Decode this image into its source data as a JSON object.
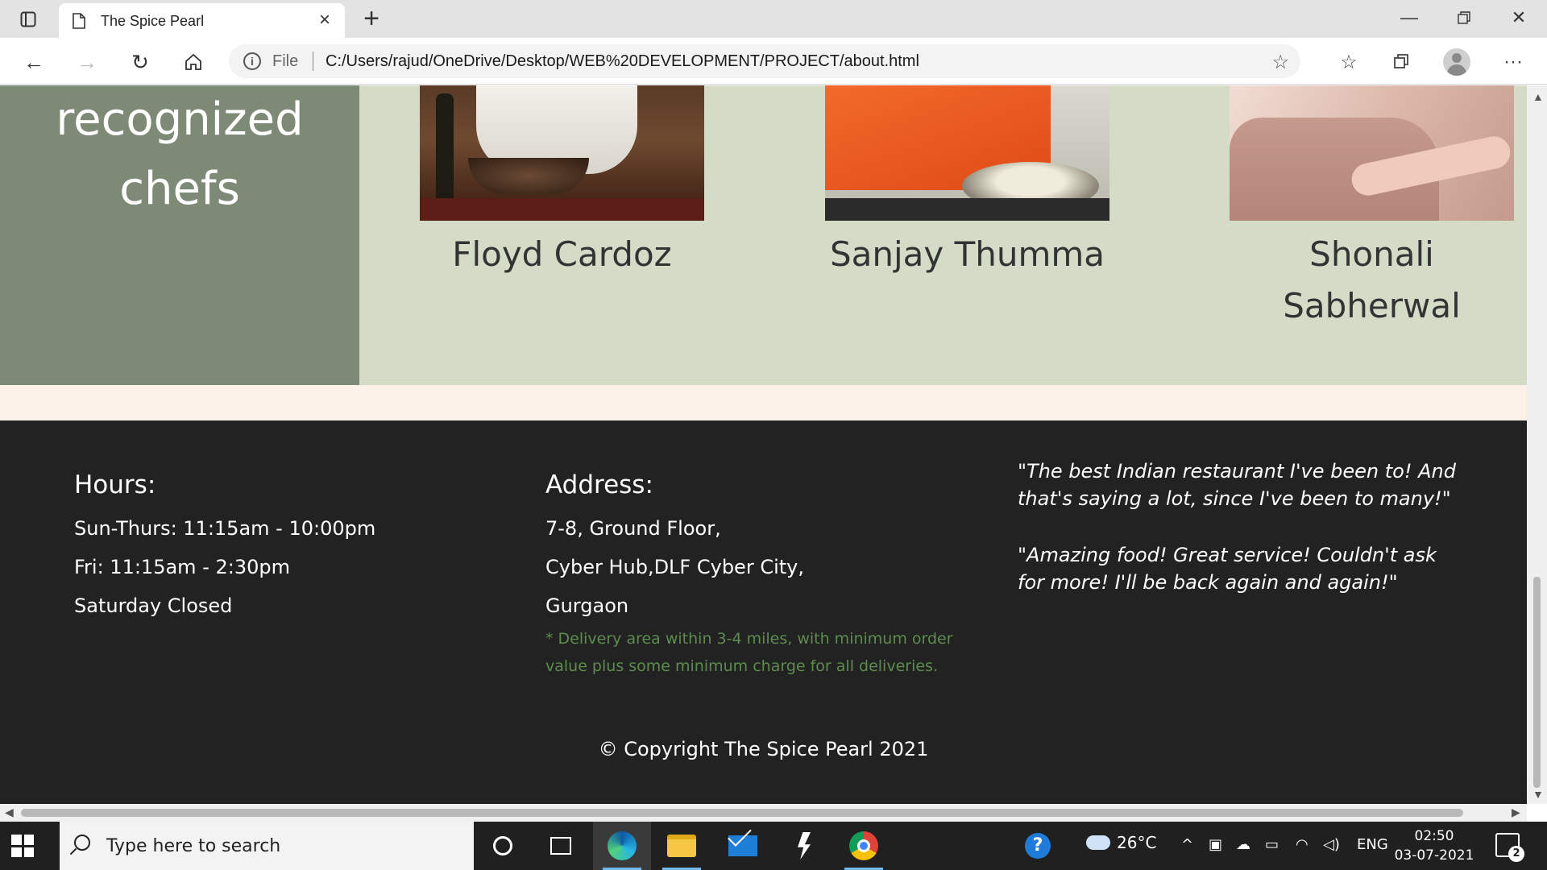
{
  "browser": {
    "tab_title": "The Spice Pearl",
    "new_tab_symbol": "+",
    "address": {
      "scheme_label": "File",
      "url": "C:/Users/rajud/OneDrive/Desktop/WEB%20DEVELOPMENT/PROJECT/about.html"
    },
    "icons": [
      "tab-actions-icon",
      "page-icon",
      "close-icon",
      "minimize-icon",
      "restore-icon",
      "window-close-icon",
      "back-icon",
      "forward-icon",
      "refresh-icon",
      "home-icon",
      "info-icon",
      "add-favorite-icon",
      "favorites-icon",
      "collections-icon",
      "profile-icon",
      "more-icon"
    ]
  },
  "page": {
    "chefs": {
      "heading_line1": "recognized",
      "heading_line2": "chefs",
      "items": [
        {
          "name": "Floyd Cardoz"
        },
        {
          "name": "Sanjay Thumma"
        },
        {
          "name_line1": "Shonali",
          "name_line2": "Sabherwal"
        }
      ]
    },
    "footer": {
      "hours": {
        "title": "Hours:",
        "lines": [
          "Sun-Thurs: 11:15am - 10:00pm",
          "Fri: 11:15am - 2:30pm",
          "Saturday Closed"
        ]
      },
      "address": {
        "title": "Address:",
        "lines": [
          "7-8, Ground Floor,",
          "Cyber Hub,DLF Cyber City,",
          "Gurgaon"
        ],
        "note": "* Delivery area within 3-4 miles, with minimum order value plus some minimum charge for all deliveries."
      },
      "quotes": [
        "\"The best Indian restaurant I've been to! And that's saying a lot, since I've been to many!\"",
        "\"Amazing food! Great service! Couldn't ask for more! I'll be back again and again!\""
      ],
      "copyright": "© Copyright The Spice Pearl 2021"
    },
    "colors": {
      "chef_left_bg": "#7d8a76",
      "chef_right_bg": "#d4dcc8",
      "cream_band": "#fbf1e8",
      "footer_bg": "#222222",
      "note_green": "#5c8c4e"
    }
  },
  "taskbar": {
    "search_placeholder": "Type here to search",
    "weather_temp": "26°C",
    "language": "ENG",
    "time": "02:50",
    "date": "03-07-2021",
    "notification_count": "2",
    "icons": [
      "start-icon",
      "search-icon",
      "cortana-icon",
      "task-view-icon",
      "edge-icon",
      "file-explorer-icon",
      "mail-icon",
      "visual-studio-icon",
      "chrome-icon",
      "help-icon",
      "weather-icon",
      "tray-chevron-icon",
      "meet-icon",
      "onedrive-icon",
      "battery-icon",
      "wifi-icon",
      "volume-icon",
      "notification-icon"
    ]
  }
}
